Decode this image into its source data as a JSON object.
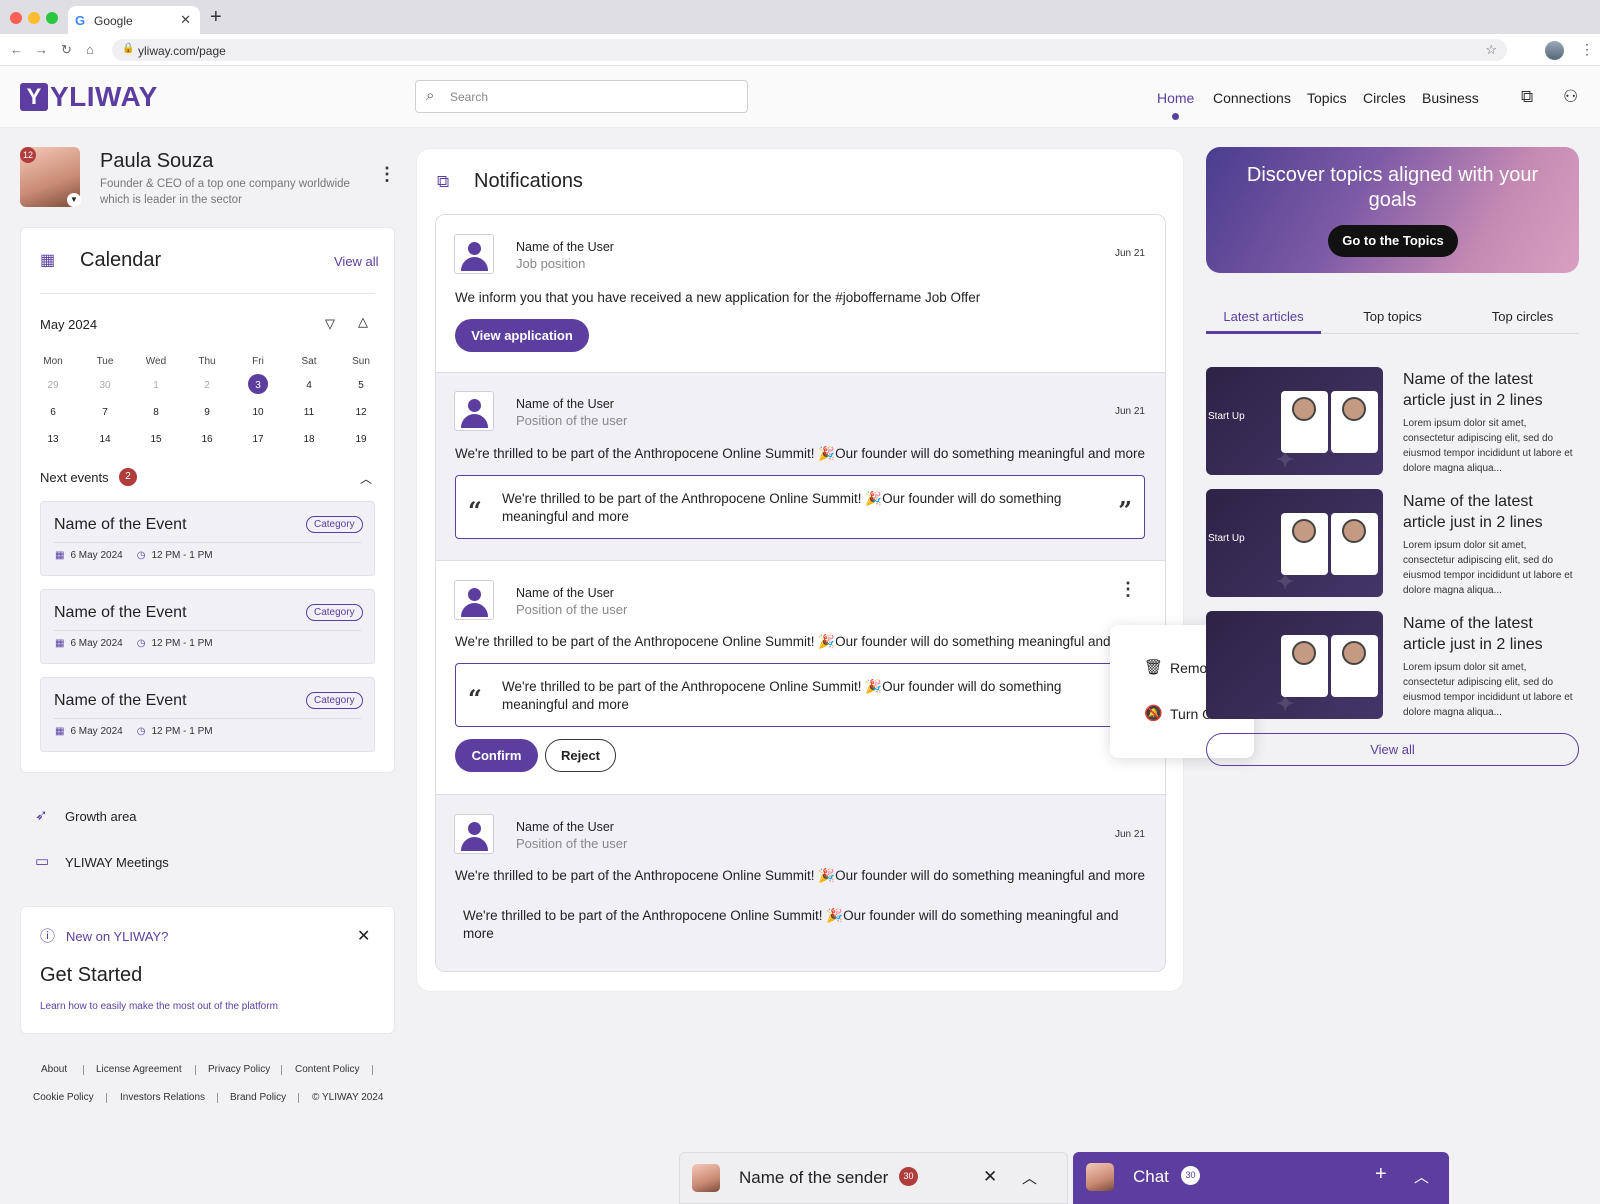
{
  "browser": {
    "tab_title": "Google",
    "url": "yliway.com/page"
  },
  "header": {
    "logo": "YLIWAY",
    "search_placeholder": "Search",
    "nav": [
      "Home",
      "Connections",
      "Topics",
      "Circles",
      "Business"
    ],
    "active_nav": "Home"
  },
  "profile": {
    "name": "Paula Souza",
    "description": "Founder & CEO of a top one company worldwide which is leader in the sector",
    "badge": "12"
  },
  "calendar": {
    "title": "Calendar",
    "view_all": "View all",
    "month": "May 2024",
    "weekdays": [
      "Mon",
      "Tue",
      "Wed",
      "Thu",
      "Fri",
      "Sat",
      "Sun"
    ],
    "weeks": [
      [
        "29",
        "30",
        "1",
        "2",
        "3",
        "4",
        "5"
      ],
      [
        "6",
        "7",
        "8",
        "9",
        "10",
        "11",
        "12"
      ],
      [
        "13",
        "14",
        "15",
        "16",
        "17",
        "18",
        "19"
      ]
    ],
    "today": "3",
    "next_events_label": "Next events",
    "next_events_count": "2",
    "events": [
      {
        "name": "Name of the Event",
        "category": "Category",
        "date": "6 May 2024",
        "time": "12 PM - 1 PM"
      },
      {
        "name": "Name of the Event",
        "category": "Category",
        "date": "6 May 2024",
        "time": "12 PM - 1 PM"
      },
      {
        "name": "Name of the Event",
        "category": "Category",
        "date": "6 May 2024",
        "time": "12 PM - 1 PM"
      }
    ]
  },
  "sidebar_links": {
    "growth": "Growth area",
    "meetings": "YLIWAY Meetings"
  },
  "get_started": {
    "kicker": "New on YLIWAY?",
    "title": "Get Started",
    "desc": "Learn how to easily make the most out of the platform"
  },
  "footer": {
    "links": [
      "About",
      "License Agreement",
      "Privacy Policy",
      "Content Policy",
      "Cookie Policy",
      "Investors Relations",
      "Brand Policy",
      "© YLIWAY 2024"
    ]
  },
  "notifications": {
    "title": "Notifications",
    "items": [
      {
        "user": "Name of the User",
        "position": "Job position",
        "date": "Jun 21",
        "text": "We inform you that you have received a new application for the #joboffername Job Offer",
        "button": "View application"
      },
      {
        "user": "Name of the User",
        "position": "Position of the user",
        "date": "Jun 21",
        "text": "We're thrilled to be part of the Anthropocene Online Summit! 🎉Our founder will do something meaningful and more",
        "quote": "We're thrilled to be part of the Anthropocene Online Summit! 🎉Our founder will do something meaningful and more"
      },
      {
        "user": "Name of the User",
        "position": "Position of the user",
        "text": "We're thrilled to be part of the Anthropocene Online Summit! 🎉Our founder will do something meaningful and more",
        "quote": "We're thrilled to be part of the Anthropocene Online Summit! 🎉Our founder will do something meaningful and more",
        "confirm": "Confirm",
        "reject": "Reject"
      },
      {
        "user": "Name of the User",
        "position": "Position of the user",
        "date": "Jun 21",
        "text": "We're thrilled to be part of the Anthropocene Online Summit! 🎉Our founder will do something meaningful and more",
        "quote": "We're thrilled to be part of the Anthropocene Online Summit! 🎉Our founder will do something meaningful and more"
      }
    ],
    "menu": {
      "remove": "Remove",
      "turn_off": "Turn Off"
    }
  },
  "promo": {
    "title": "Discover topics aligned with your goals",
    "button": "Go to the Topics"
  },
  "right_tabs": [
    "Latest articles",
    "Top topics",
    "Top circles"
  ],
  "articles": [
    {
      "title": "Name of the latest article just in 2 lines",
      "desc": "Lorem ipsum dolor sit amet, consectetur adipiscing elit, sed do eiusmod tempor incididunt ut labore et dolore magna aliqua...",
      "img_label": "Start Up"
    },
    {
      "title": "Name of the latest article just in 2 lines",
      "desc": "Lorem ipsum dolor sit amet, consectetur adipiscing elit, sed do eiusmod tempor incididunt ut labore et dolore magna aliqua...",
      "img_label": "Start Up"
    },
    {
      "title": "Name of the latest article just in 2 lines",
      "desc": "Lorem ipsum dolor sit amet, consectetur adipiscing elit, sed do eiusmod tempor incididunt ut labore et dolore magna aliqua...",
      "img_label": ""
    }
  ],
  "articles_view_all": "View all",
  "chat": {
    "sender": "Name of the sender",
    "sender_count": "30",
    "title": "Chat",
    "count": "30"
  },
  "colors": {
    "accent": "#5b3ea0",
    "badge": "#b13c3c"
  }
}
